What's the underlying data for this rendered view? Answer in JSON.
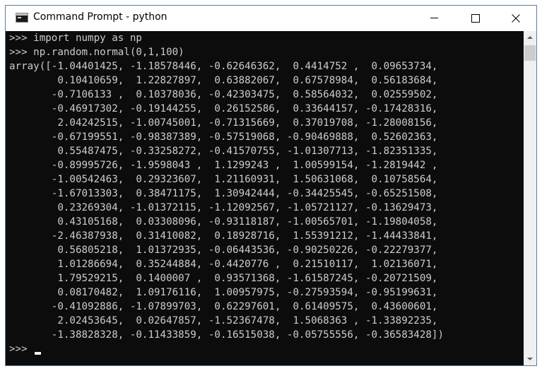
{
  "window": {
    "title": "Command Prompt - python",
    "icon": "cmd-icon"
  },
  "titlebar_buttons": {
    "minimize": "minimize-icon",
    "maximize": "maximize-icon",
    "close": "close-icon"
  },
  "console": {
    "lines": [
      ">>> import numpy as np",
      ">>> np.random.normal(0,1,100)",
      "array([-1.04401425, -1.18578446, -0.62646362,  0.4414752 ,  0.09653734,",
      "        0.10410659,  1.22827897,  0.63882067,  0.67578984,  0.56183684,",
      "       -0.7106133 ,  0.10378036, -0.42303475,  0.58564032,  0.02559502,",
      "       -0.46917302, -0.19144255,  0.26152586,  0.33644157, -0.17428316,",
      "        2.04242515, -1.00745001, -0.71315669,  0.37019708, -1.28008156,",
      "       -0.67199551, -0.98387389, -0.57519068, -0.90469888,  0.52602363,",
      "        0.55487475, -0.33258272, -0.41570755, -1.01307713, -1.82351335,",
      "       -0.89995726, -1.9598043 ,  1.1299243 ,  1.00599154, -1.2819442 ,",
      "       -1.00542463,  0.29323607,  1.21160931,  1.50631068,  0.10758564,",
      "       -1.67013303,  0.38471175,  1.30942444, -0.34425545, -0.65251508,",
      "        0.23269304, -1.01372115, -1.12092567, -1.05721127, -0.13629473,",
      "        0.43105168,  0.03308096, -0.93118187, -1.00565701, -1.19804058,",
      "       -2.46387938,  0.31410082,  0.18928716,  1.55391212, -1.44433841,",
      "        0.56805218,  1.01372935, -0.06443536, -0.90250226, -0.22279377,",
      "        1.01286694,  0.35244884, -0.4420776 ,  0.21510117,  1.02136071,",
      "        1.79529215,  0.1400007 ,  0.93571368, -1.61587245, -0.20721509,",
      "        0.08170482,  1.09176116,  1.00957975, -0.27593594, -0.95199631,",
      "       -0.41092886, -1.07899703,  0.62297601,  0.61409575,  0.43600601,",
      "        2.02453645,  0.02647857, -1.52367478,  1.5068363 , -1.33892235,",
      "       -1.38828328, -0.11433859, -0.16515038, -0.05755556, -0.36583428])",
      "",
      ">>> "
    ]
  },
  "scrollbar": {
    "up": "scroll-up-arrow-icon",
    "down": "scroll-down-arrow-icon"
  }
}
